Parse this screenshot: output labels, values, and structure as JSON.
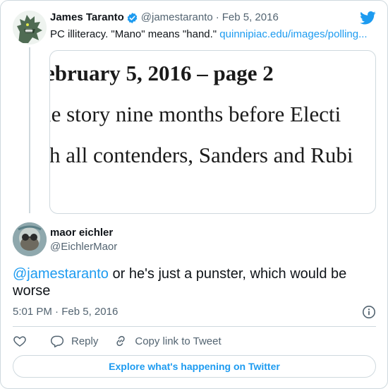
{
  "parent_tweet": {
    "name": "James Taranto",
    "handle": "@jamestaranto",
    "separator": "·",
    "date": "Feb 5, 2016",
    "text": "PC illiteracy. \"Mano\" means \"hand.\" ",
    "link_text": "quinnipiac.edu/images/polling...",
    "media_lines": [
      "ebruary 5, 2016 – page 2",
      "le story nine months before Electi",
      "h all contenders, Sanders and Rubi"
    ]
  },
  "reply_tweet": {
    "name": "maor eichler",
    "handle": "@EichlerMaor",
    "mention": "@jamestaranto",
    "text": " or he's just a punster, which would be worse",
    "time": "5:01 PM",
    "separator": "·",
    "date": "Feb 5, 2016"
  },
  "actions": {
    "reply_label": "Reply",
    "copy_label": "Copy link to Tweet"
  },
  "explore_label": "Explore what's happening on Twitter",
  "icons": {
    "brand": "twitter-bird-icon",
    "verified": "verified-badge-icon",
    "info": "info-icon",
    "like": "heart-icon",
    "reply": "speech-bubble-icon",
    "copy": "link-icon"
  },
  "colors": {
    "accent": "#1d9bf0",
    "text": "#0f1419",
    "muted": "#536471",
    "border": "#cfd9de"
  }
}
